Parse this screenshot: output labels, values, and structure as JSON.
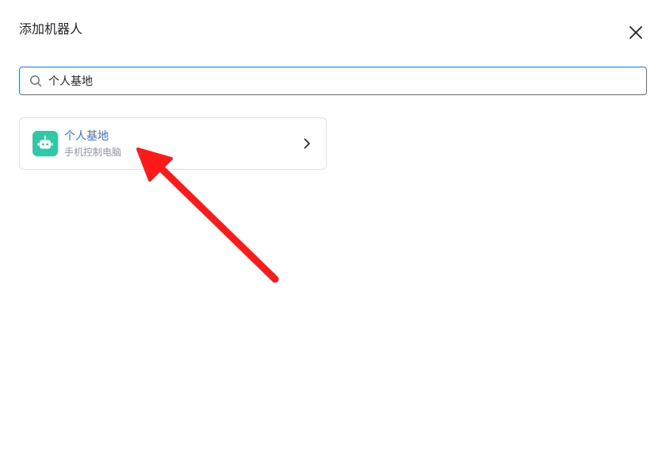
{
  "dialog": {
    "title": "添加机器人",
    "close_icon": "close-icon"
  },
  "search": {
    "value": "个人基地",
    "icon": "search-icon"
  },
  "results": [
    {
      "name": "个人基地",
      "description": "手机控制电脑",
      "icon": "robot-icon",
      "chevron": "chevron-right-icon"
    }
  ],
  "colors": {
    "accent": "#3370ff",
    "bot_avatar": "#2fc9a8",
    "annotation_arrow": "#ff1a1a",
    "muted_text": "#8f959e",
    "border": "#dee0e3"
  }
}
